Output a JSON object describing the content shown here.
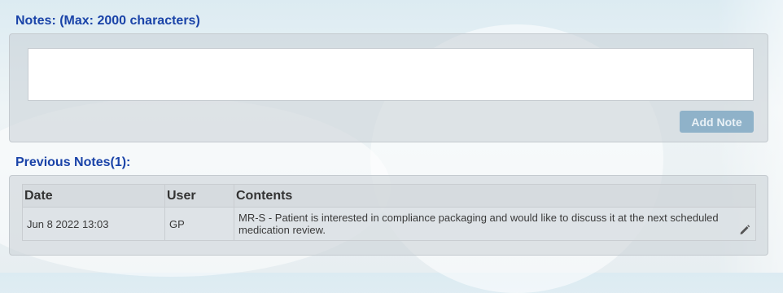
{
  "notes_section": {
    "title": "Notes: (Max: 2000 characters)",
    "textarea_value": "",
    "add_button_label": "Add Note"
  },
  "previous_notes": {
    "title": "Previous Notes(1):",
    "columns": [
      "Date",
      "User",
      "Contents"
    ],
    "rows": [
      {
        "date": "Jun 8 2022 13:03",
        "user": "GP",
        "contents": "MR-S - Patient is interested in compliance packaging and would like to discuss it at the next scheduled medication review.",
        "action_icon": "pencil-edit-icon"
      }
    ]
  },
  "colors": {
    "title_blue": "#1a43a8",
    "button_bg": "#8fb2c9"
  }
}
